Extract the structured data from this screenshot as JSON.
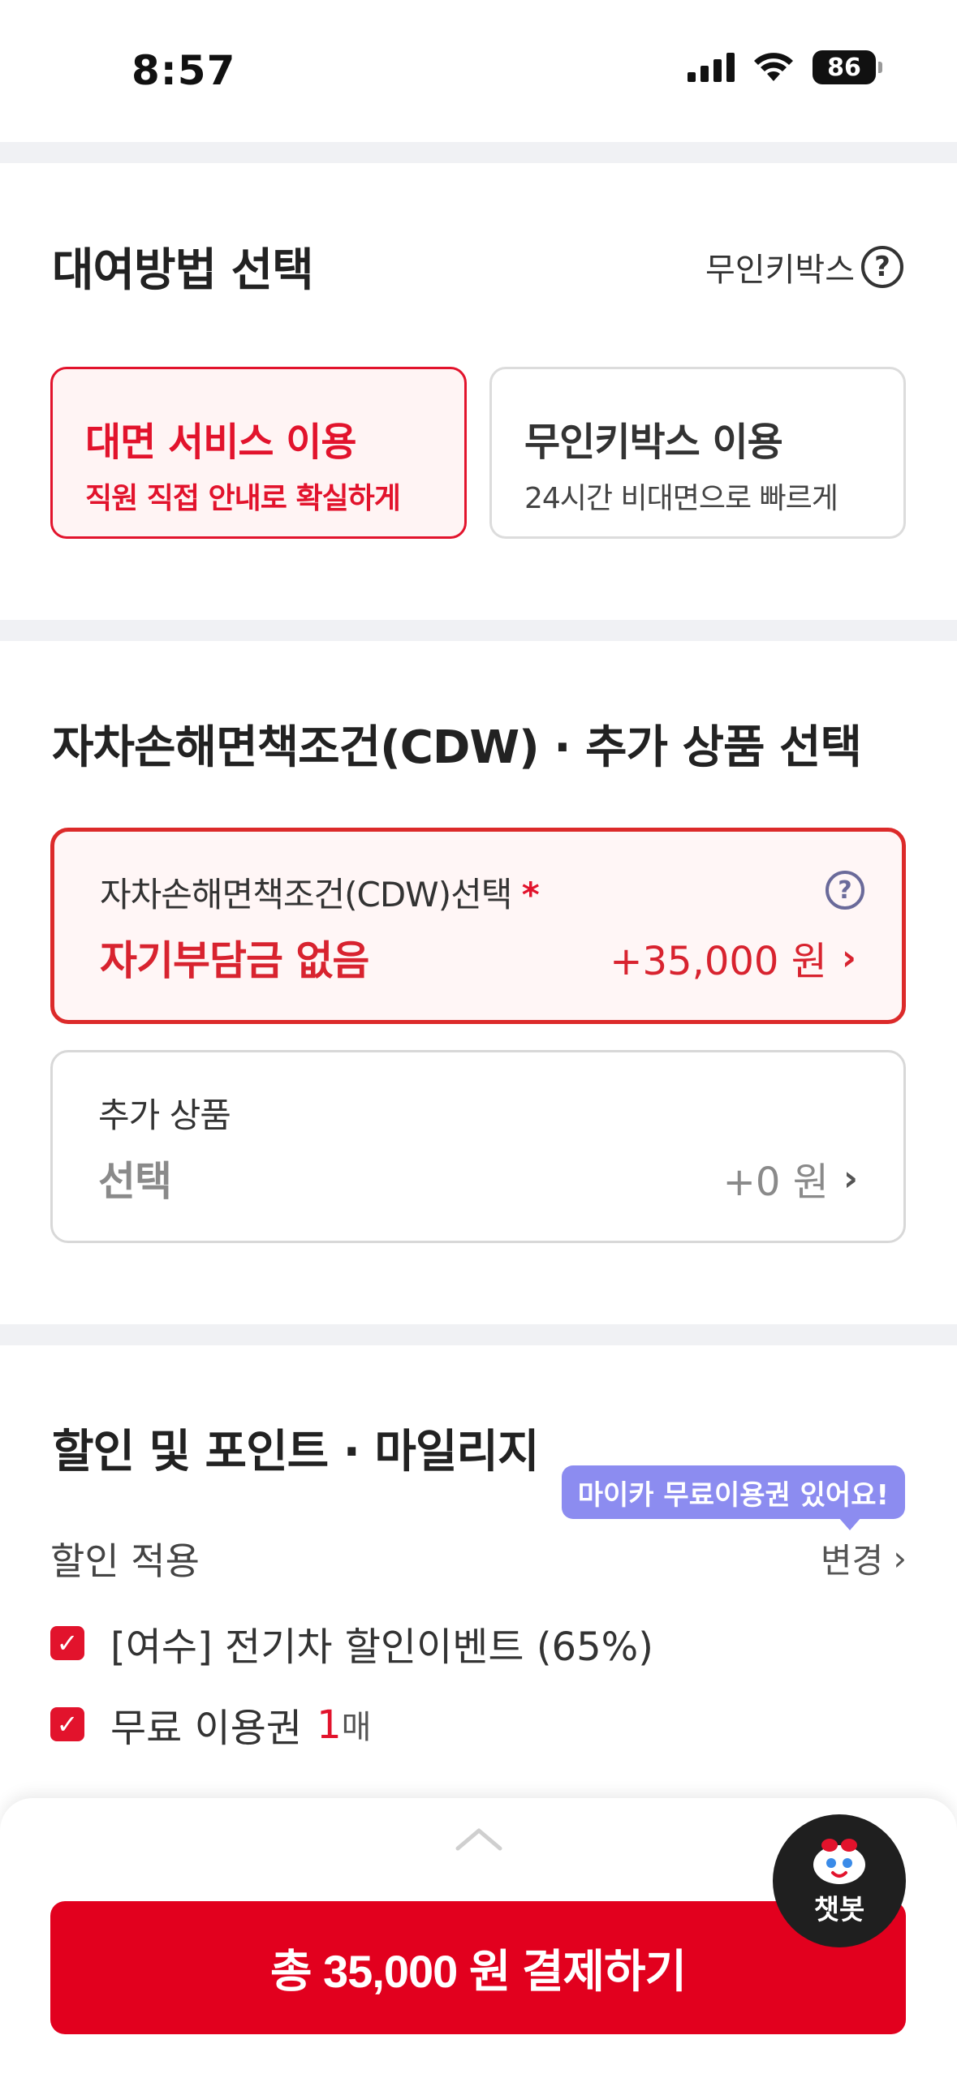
{
  "status_bar": {
    "time": "8:57",
    "battery": "86",
    "icons": [
      "cellular-signal-icon",
      "wifi-icon",
      "battery-icon"
    ]
  },
  "rental_method": {
    "title": "대여방법 선택",
    "help_link": "무인키박스",
    "help_icon": "?",
    "options": [
      {
        "title": "대면 서비스 이용",
        "subtitle": "직원 직접 안내로 확실하게",
        "selected": true
      },
      {
        "title": "무인키박스 이용",
        "subtitle": "24시간 비대면으로 빠르게",
        "selected": false
      }
    ]
  },
  "cdw_section": {
    "title": "자차손해면책조건(CDW) · 추가 상품 선택",
    "cdw": {
      "label": "자차손해면책조건(CDW)선택",
      "required_mark": "*",
      "help_icon": "?",
      "value": "자기부담금 없음",
      "price": "+35,000 원"
    },
    "addon": {
      "label": "추가 상품",
      "value": "선택",
      "price": "+0 원"
    }
  },
  "discount_section": {
    "title": "할인 및 포인트 · 마일리지",
    "tooltip": "마이카 무료이용권 있어요!",
    "apply_label": "할인 적용",
    "change_label": "변경",
    "items": [
      {
        "label": "[여수] 전기차 할인이벤트 (65%)",
        "checked": true
      },
      {
        "label": "무료 이용권",
        "count": "1",
        "unit": "매",
        "checked": true
      }
    ]
  },
  "bottom_bar": {
    "pay_button": "총 35,000 원 결제하기"
  },
  "chatbot": {
    "label": "챗봇"
  },
  "colors": {
    "accent": "#e2001e",
    "selected_bg": "#fff4f4",
    "tooltip_bg": "#8c8cf0",
    "divider": "#f0f1f4"
  }
}
